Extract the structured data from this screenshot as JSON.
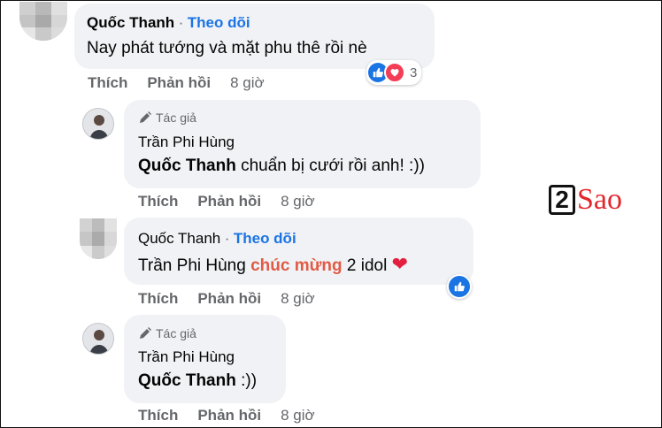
{
  "comment1": {
    "author": "Quốc Thanh",
    "separator": "·",
    "follow": "Theo dõi",
    "text": "Nay phát tướng và mặt phu thê rồi nè",
    "reactions": {
      "count": "3",
      "icons": [
        "like-icon",
        "heart-icon"
      ]
    },
    "actions": {
      "like": "Thích",
      "reply": "Phản hồi",
      "time": "8 giờ"
    }
  },
  "reply1": {
    "badge": "Tác giả",
    "author": "Trần Phi Hùng",
    "mention": "Quốc Thanh",
    "text": " chuẩn bị cưới rồi anh! :))",
    "actions": {
      "like": "Thích",
      "reply": "Phản hồi",
      "time": "8 giờ"
    }
  },
  "reply2": {
    "author": "Quốc Thanh",
    "separator": "·",
    "follow": "Theo dõi",
    "mention": "Trần Phi Hùng",
    "highlight": "chúc mừng",
    "text": " 2 idol ",
    "emoji": "❤",
    "reaction_icon": "like-icon",
    "actions": {
      "like": "Thích",
      "reply": "Phản hồi",
      "time": "8 giờ"
    }
  },
  "reply3": {
    "badge": "Tác giả",
    "author": "Trần Phi Hùng",
    "mention": "Quốc Thanh",
    "text": " :))",
    "actions": {
      "like": "Thích",
      "reply": "Phản hồi",
      "time": "8 giờ"
    }
  },
  "watermark": {
    "digit": "2",
    "word": "Sao"
  },
  "colors": {
    "link": "#1b74e4",
    "highlight": "#e25a45",
    "bubble": "#f0f2f5",
    "heart": "#e41e3f",
    "watermark": "#e3262d"
  }
}
